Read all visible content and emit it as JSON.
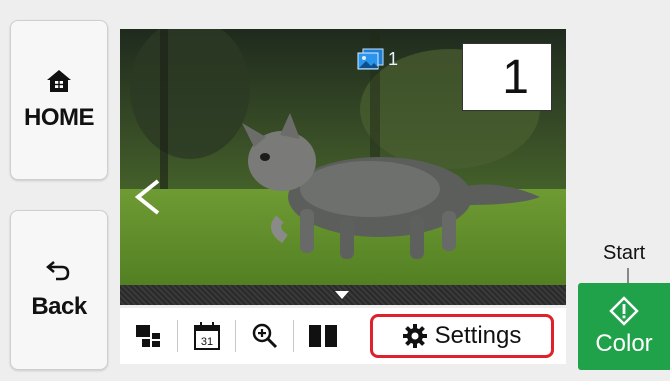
{
  "sidebar": {
    "home_label": "HOME",
    "back_label": "Back"
  },
  "preview": {
    "copy_count": "1",
    "page_number": "1"
  },
  "toolbar": {
    "calendar_day": "31",
    "settings_label": "Settings"
  },
  "start": {
    "label": "Start",
    "color_label": "Color"
  },
  "colors": {
    "start_button": "#20a24a",
    "highlight": "#e0202a"
  }
}
